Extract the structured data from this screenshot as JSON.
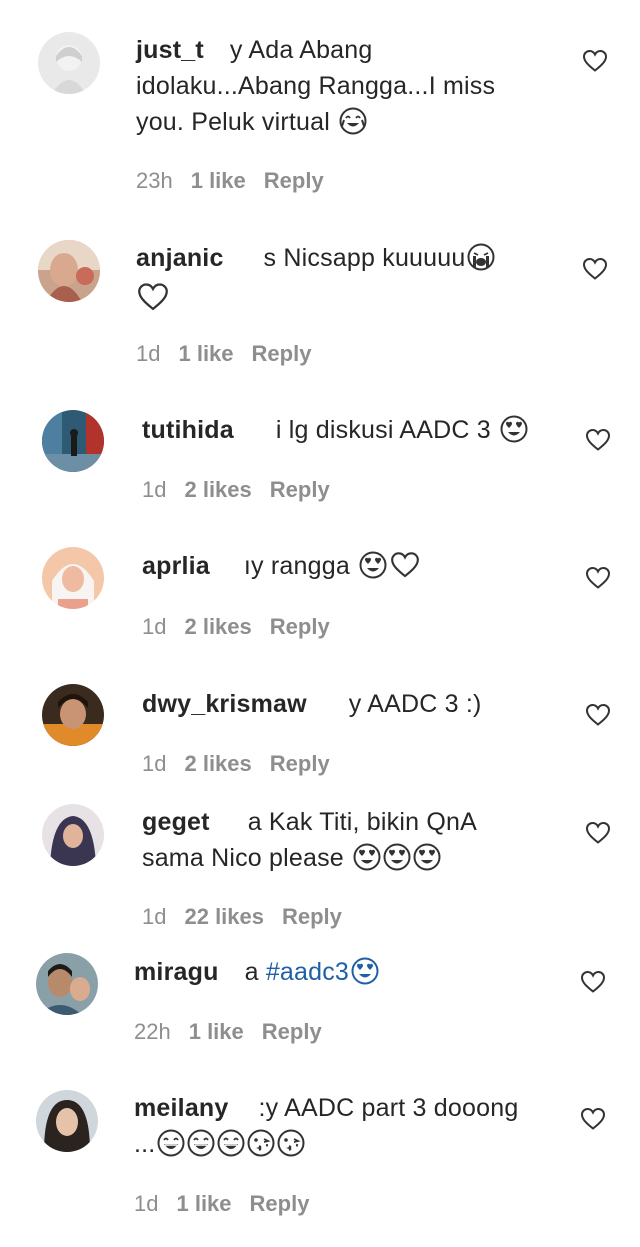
{
  "comments": [
    {
      "username": "just_t",
      "text_lines": [
        "y Ada Abang",
        "idolaku...Abang Rangga...I miss",
        "you. Peluk virtual"
      ],
      "time": "23h",
      "likes": "1 like",
      "reply": "Reply"
    },
    {
      "username": "anjanic",
      "text_lines": [
        "s Nicsapp kuuuuu"
      ],
      "time": "1d",
      "likes": "1 like",
      "reply": "Reply"
    },
    {
      "username": "tutihida",
      "text_lines": [
        "i lg diskusi AADC 3"
      ],
      "time": "1d",
      "likes": "2 likes",
      "reply": "Reply"
    },
    {
      "username": "aprlia",
      "text_lines": [
        "ıy rangga"
      ],
      "time": "1d",
      "likes": "2 likes",
      "reply": "Reply"
    },
    {
      "username": "dwy_krismaw",
      "text_lines": [
        "y AADC 3 :)"
      ],
      "time": "1d",
      "likes": "2 likes",
      "reply": "Reply"
    },
    {
      "username": "geget",
      "text_lines": [
        "a Kak Titi, bikin QnA",
        "sama Nico please"
      ],
      "time": "1d",
      "likes": "22 likes",
      "reply": "Reply"
    },
    {
      "username": "miragu",
      "text_lines": [
        "a "
      ],
      "hashtag": "#aadc3",
      "time": "22h",
      "likes": "1 like",
      "reply": "Reply"
    },
    {
      "username": "meilany",
      "text_lines": [
        ":y AADC part 3 dooong",
        "..."
      ],
      "time": "1d",
      "likes": "1 like",
      "reply": "Reply"
    }
  ],
  "colors": {
    "text": "#262626",
    "meta": "#8e8e8e",
    "hashtag": "#1f5fa8"
  },
  "icons": [
    "heart-outline-icon",
    "smiling-face-tears-emoji",
    "loudly-crying-emoji",
    "heart-eyes-emoji",
    "grinning-emoji",
    "kiss-emoji"
  ]
}
